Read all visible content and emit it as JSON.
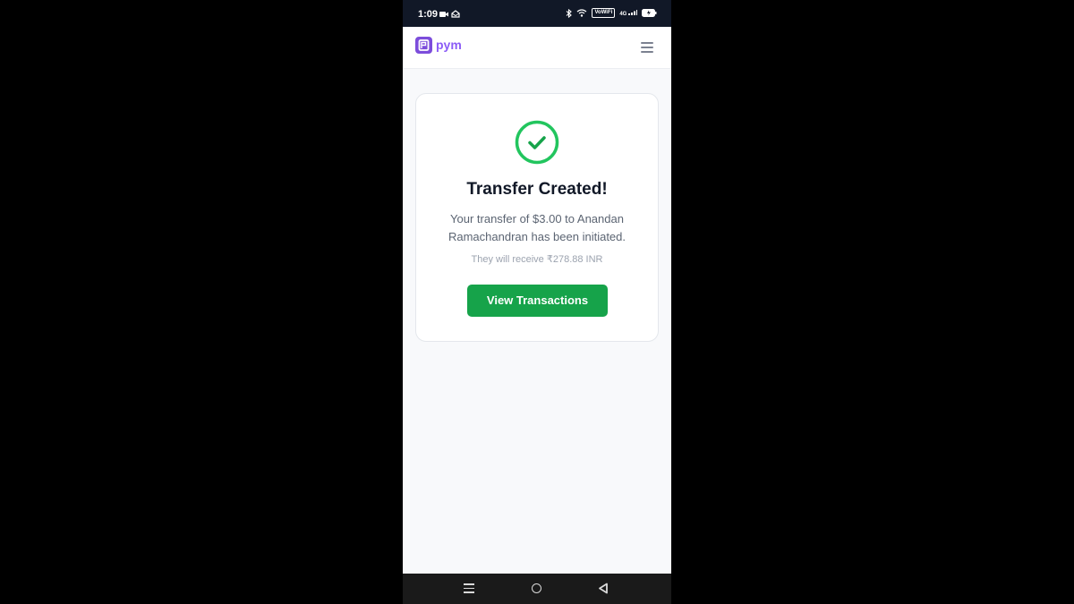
{
  "status_bar": {
    "time": "1:09",
    "vowifi_label": "VoWiFi",
    "network_label": "4G"
  },
  "app": {
    "logo_icon": "pym-logo-icon",
    "name": "pym",
    "brand_color": "#8b5cf6",
    "menu_icon": "hamburger-menu-icon"
  },
  "confirmation": {
    "icon": "check-circle-icon",
    "title": "Transfer Created!",
    "message": "Your transfer of $3.00 to Anandan Ramachandran has been initiated.",
    "receive_note": "They will receive ₹278.88 INR",
    "button_label": "View Transactions",
    "accent_color": "#16a34a"
  },
  "nav_bar": {
    "recents_icon": "recents-icon",
    "home_icon": "home-icon",
    "back_icon": "back-icon"
  }
}
